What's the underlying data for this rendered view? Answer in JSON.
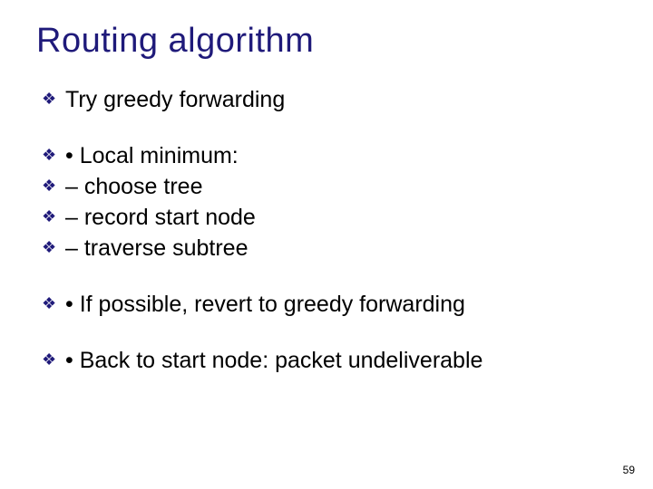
{
  "title": "Routing algorithm",
  "bullets": [
    "Try greedy forwarding",
    "• Local minimum:",
    "– choose tree",
    "– record start node",
    "– traverse subtree",
    "• If possible, revert to greedy forwarding",
    "• Back to start node: packet undeliverable"
  ],
  "page_number": "59",
  "glyph": "❖"
}
